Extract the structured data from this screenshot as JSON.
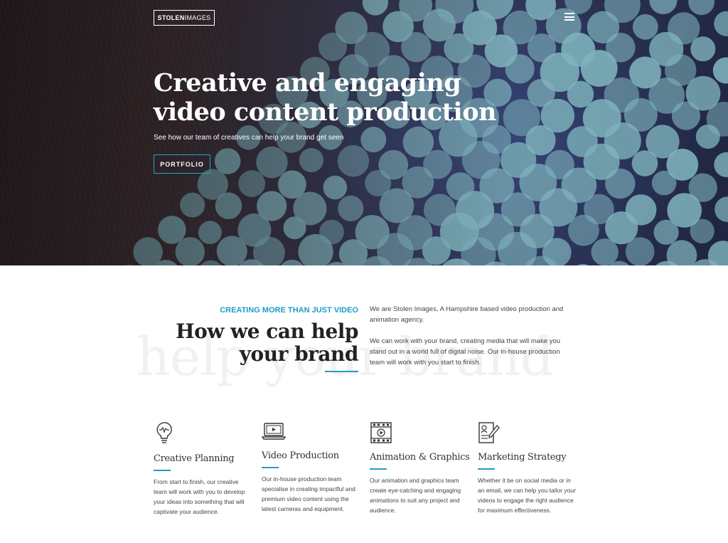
{
  "header": {
    "logo_bold": "STOLEN",
    "logo_light": "IMAGES"
  },
  "hero": {
    "title_line1": "Creative and engaging",
    "title_line2": "video content production",
    "subtitle": "See how our team of creatives can help your brand get seen",
    "cta_label": "PORTFOLIO"
  },
  "intro": {
    "eyebrow": "CREATING MORE THAN JUST VIDEO",
    "title_line1": "How we can help",
    "title_line2": "your brand",
    "watermark": "help your brand",
    "paragraph1": "We are Stolen Images, A Hampshire based video production and animation agency.",
    "paragraph2": "We can work with your brand, creating media that will make you stand out in a world full of digital noise. Our in-house production team will work with you start to finish."
  },
  "services": [
    {
      "icon": "lightbulb-icon",
      "title": "Creative Planning",
      "text": "From start to finish, our creative team will work with you to develop your ideas into something that will captivate your audience."
    },
    {
      "icon": "laptop-video-icon",
      "title": "Video Production",
      "text": "Our in-house production team specialise in creating impactful and premium video content using the latest cameras and equipment."
    },
    {
      "icon": "film-strip-icon",
      "title": "Animation & Graphics",
      "text": "Our animation and graphics team create eye-catching and engaging animations to suit any project and audience."
    },
    {
      "icon": "document-pen-icon",
      "title": "Marketing Strategy",
      "text": "Whether it be on social media or in an email, we can help you tailor your videos to engage the right audience for maximum effectiveness."
    }
  ],
  "colors": {
    "accent": "#1f9dc6",
    "hero_fabric": "#2c3458",
    "dot": "#7fb3bd"
  }
}
